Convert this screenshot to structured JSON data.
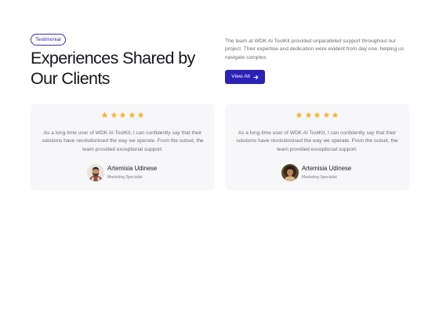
{
  "header": {
    "badge": "Testimonial",
    "title_line1": "Experiences Shared by",
    "title_line2": "Our Clients",
    "lead": "The team at WDK AI ToolKit provided unparalleled support throughout our project. Their expertise and dedication were evident from day one, helping us navigate complex.",
    "view_all_label": "View All",
    "view_all_icon": "arrow-right-icon"
  },
  "colors": {
    "accent": "#2c21b6",
    "star": "#f4b740",
    "card_bg": "#f7f7f9",
    "muted_text": "#6b6b76"
  },
  "testimonials": [
    {
      "rating": 5,
      "rating_max": 5,
      "quote": "As a long-time user of WDK AI ToolKit, I can confidently say that their solutions have revolutionised the way we operate. From the outset, the team provided exceptional support.",
      "name": "Artemisia Udinese",
      "role": "Marketing Specialist",
      "avatar_icon": "avatar-man-beard"
    },
    {
      "rating": 5,
      "rating_max": 5,
      "quote": "As a long-time user of WDK AI ToolKit, I can confidently say that their solutions have revolutionised the way we operate. From the outset, the team provided exceptional support.",
      "name": "Artemisia Udinese",
      "role": "Marketing Specialist",
      "avatar_icon": "avatar-woman-curly-hair"
    }
  ]
}
